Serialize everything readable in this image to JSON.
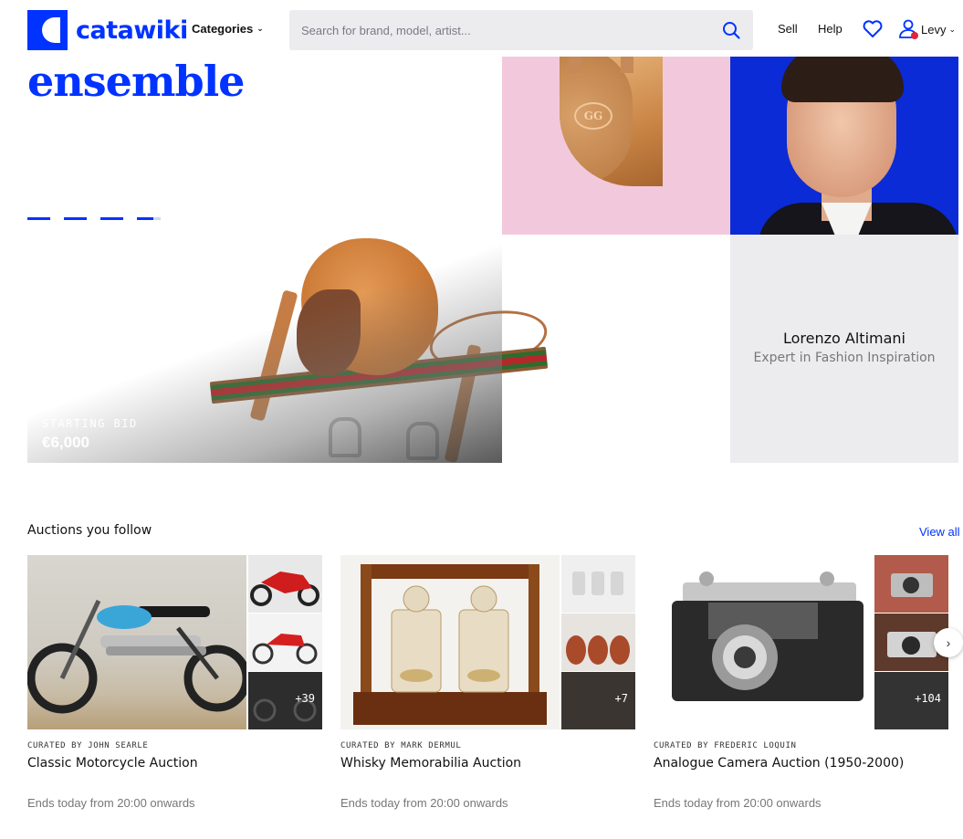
{
  "header": {
    "logo_text": "catawiki",
    "categories_label": "Categories",
    "search_placeholder": "Search for brand, model, artist...",
    "sell_label": "Sell",
    "help_label": "Help",
    "user_name": "Levy"
  },
  "hero": {
    "title": "ensemble",
    "starting_bid_label": "STARTING BID",
    "starting_bid_value": "€6,000",
    "slide_count": 4,
    "expert": {
      "name": "Lorenzo Altimani",
      "role": "Expert in Fashion Inspiration"
    }
  },
  "auctions": {
    "title": "Auctions you follow",
    "view_all_label": "View all",
    "items": [
      {
        "curator": "CURATED BY JOHN SEARLE",
        "title": "Classic Motorcycle Auction",
        "ends": "Ends today from 20:00 onwards",
        "more_count": "+39"
      },
      {
        "curator": "CURATED BY MARK DERMUL",
        "title": "Whisky Memorabilia Auction",
        "ends": "Ends today from 20:00 onwards",
        "more_count": "+7"
      },
      {
        "curator": "CURATED BY FREDERIC LOQUIN",
        "title": "Analogue Camera Auction (1950-2000)",
        "ends": "Ends today from 20:00 onwards",
        "more_count": "+104"
      }
    ]
  },
  "colors": {
    "brand": "#0033ff",
    "search_bg": "#ececef",
    "hero_pink": "#f2c9dc"
  }
}
